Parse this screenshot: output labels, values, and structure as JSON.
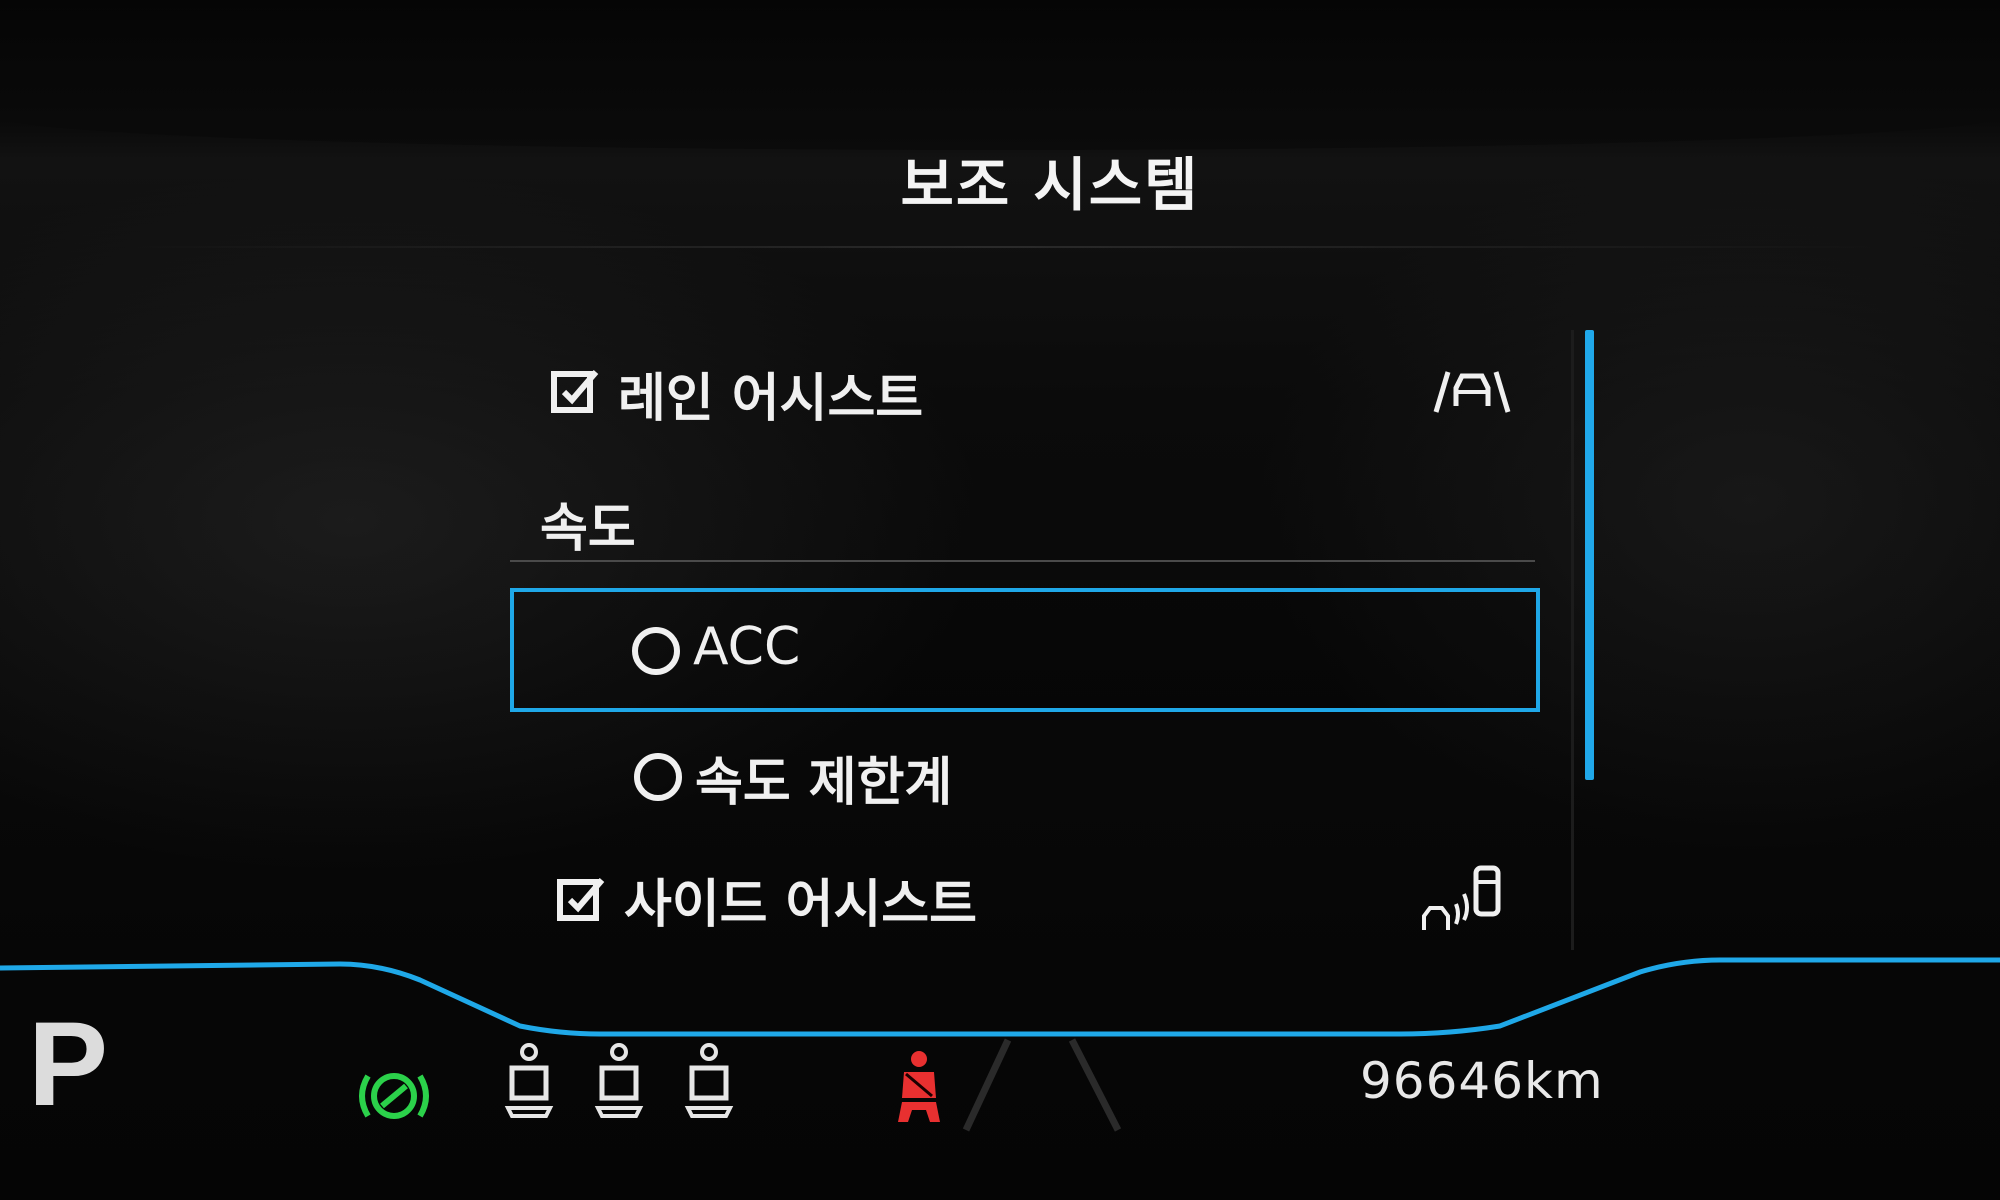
{
  "header": {
    "title": "보조 시스템"
  },
  "menu": {
    "items": [
      {
        "label": "레인 어시스트",
        "checked": true,
        "icon": "lane-assist-icon"
      },
      {
        "label": "속도",
        "type": "section-header"
      },
      {
        "label": "ACC",
        "type": "radio",
        "selected": false,
        "highlighted": true
      },
      {
        "label": "속도 제한계",
        "type": "radio",
        "selected": false
      },
      {
        "label": "사이드 어시스트",
        "checked": true,
        "icon": "side-assist-icon"
      }
    ]
  },
  "status_bar": {
    "gear": "P",
    "odometer": "96646km",
    "icons": [
      "steering-assist-icon",
      "seat-occupancy-icon",
      "seat-occupancy-icon",
      "seat-occupancy-icon",
      "seatbelt-warning-icon"
    ]
  },
  "colors": {
    "accent": "#1fa8e8",
    "warning": "#e83030",
    "active": "#2bd14a",
    "text": "#f0f0f0"
  }
}
